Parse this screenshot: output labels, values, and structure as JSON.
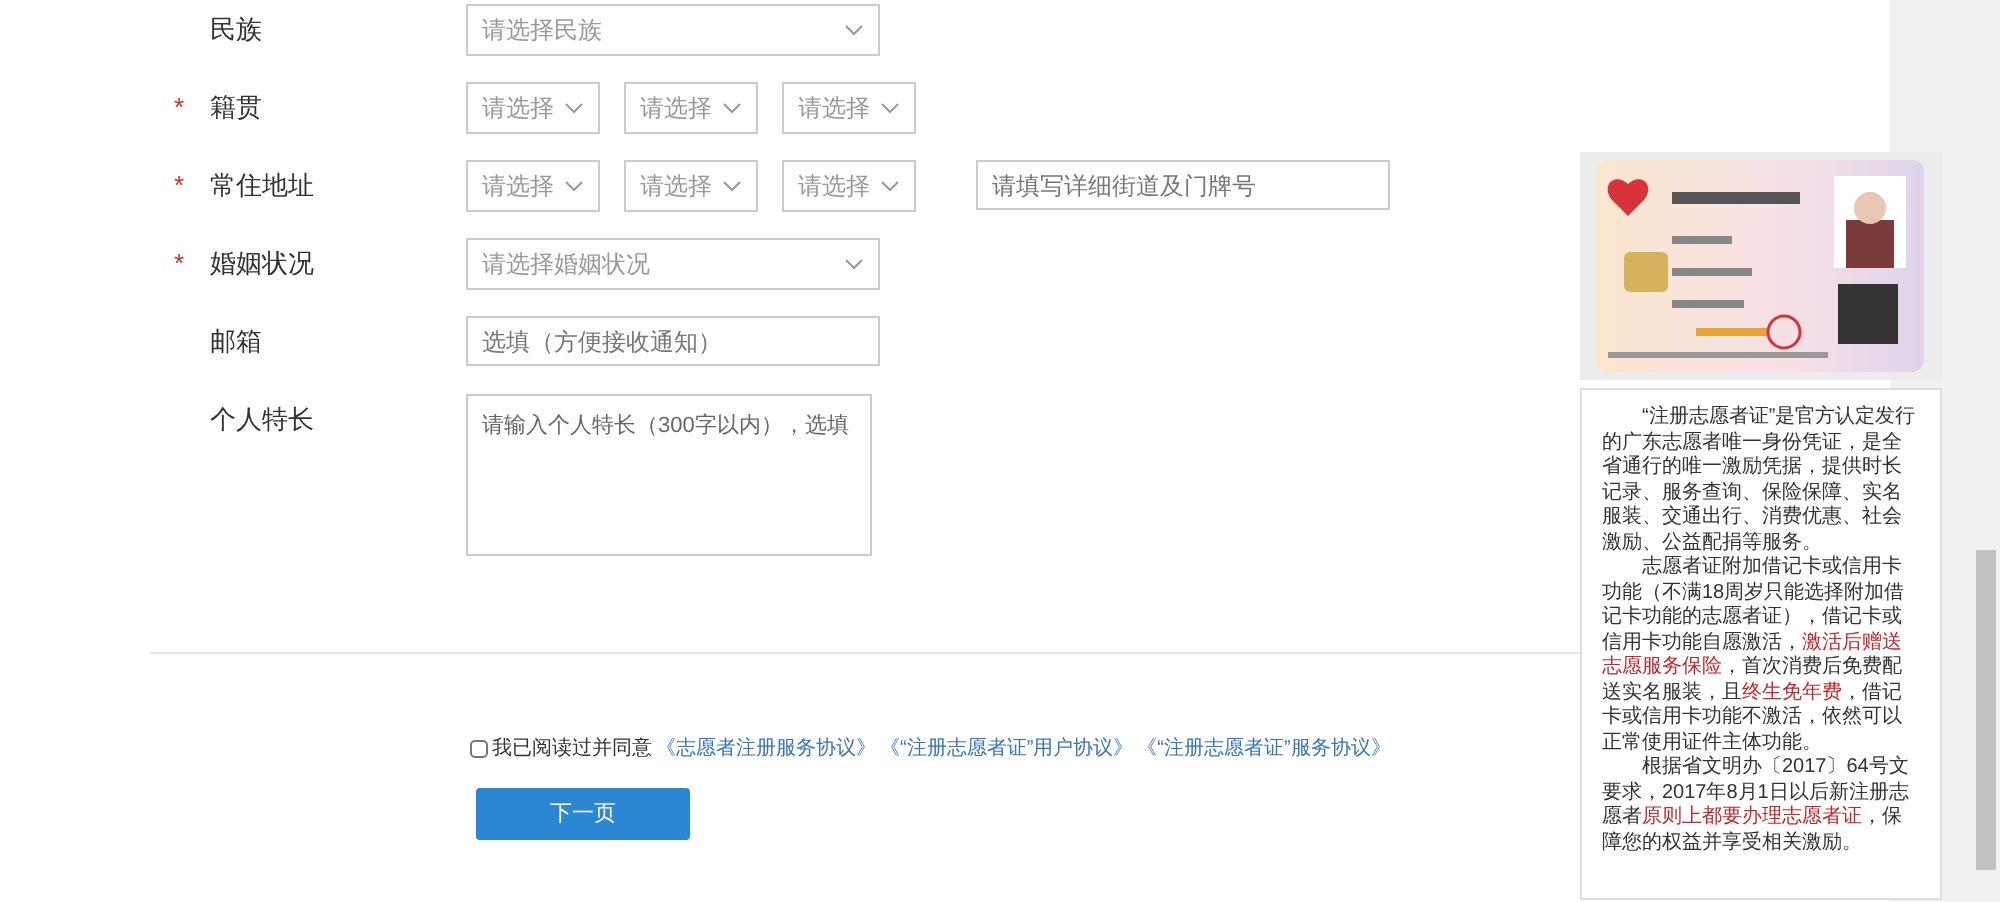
{
  "form": {
    "rows": [
      {
        "label": "民族",
        "fields": [
          {
            "kind": "select",
            "placeholder": "请选择民族"
          }
        ]
      },
      {
        "label": "籍贯",
        "marker": "*",
        "fields": [
          {
            "kind": "select",
            "placeholder": "请选择"
          },
          {
            "kind": "select",
            "placeholder": "请选择"
          },
          {
            "kind": "select",
            "placeholder": "请选择"
          }
        ]
      },
      {
        "label": "常住地址",
        "marker": "*",
        "fields": [
          {
            "kind": "select",
            "placeholder": "请选择"
          },
          {
            "kind": "select",
            "placeholder": "请选择"
          },
          {
            "kind": "select",
            "placeholder": "请选择"
          },
          {
            "kind": "input",
            "placeholder": "请填写详细街道及门牌号"
          }
        ]
      },
      {
        "label": "婚姻状况",
        "marker": "*",
        "fields": [
          {
            "kind": "select",
            "placeholder": "请选择婚姻状况"
          }
        ]
      },
      {
        "label": "邮箱",
        "fields": [
          {
            "kind": "input",
            "placeholder": "选填（方便接收通知）"
          }
        ]
      },
      {
        "label": "个人特长",
        "fields": [
          {
            "kind": "textarea",
            "placeholder": "请输入个人特长（300字以内），选填"
          }
        ]
      }
    ]
  },
  "agreement": {
    "checked": false,
    "text": "我已阅读过并同意",
    "links": [
      "《志愿者注册服务协议》",
      "《“注册志愿者证”用户协议》",
      "《“注册志愿者证”服务协议》"
    ]
  },
  "next_button": "下一页",
  "side_panel": {
    "card": {
      "kind": "picture"
    },
    "paragraphs": [
      "“注册志愿者证”是官方认定发行的广东志愿者唯一身份凭证，是全省通行的唯一激励凭据，提供时长记录、服务查询、保险保障、实名服装、交通出行、消费优惠、社会激励、公益配捐等服务。",
      "志愿者证附加借记卡或信用卡功能（不满18周岁只能选择附加借记卡功能的志愿者证），借记卡或信用卡功能自愿激活，**激活后赠送志愿服务保险**，首次消费后免费配送实名服装，且**终生免年费**，借记卡或信用卡功能不激活，依然可以正常使用证件主体功能。",
      "根据省文明办〔2017〕64号文要求，2017年8月1日以后新注册志愿者**原则上都要办理志愿者证**，保障您的权益并享受相关激励。"
    ]
  }
}
